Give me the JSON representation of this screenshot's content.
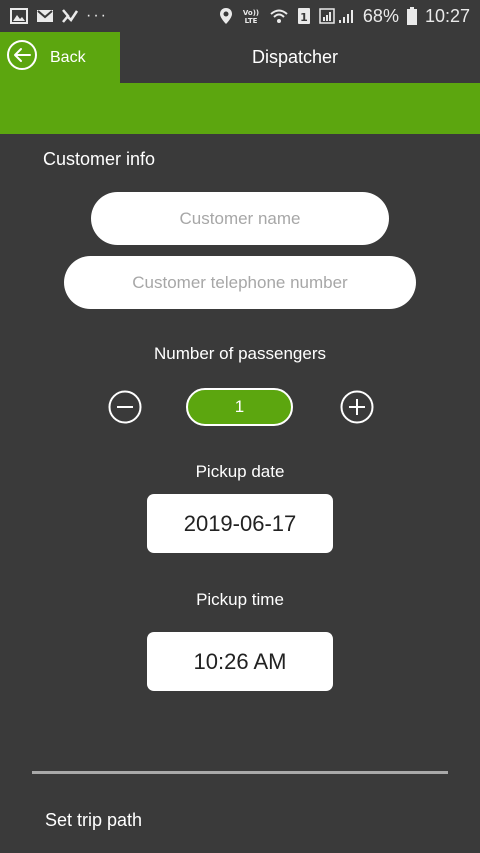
{
  "status_bar": {
    "dots": "···",
    "network_label": "VoLTE",
    "sim_badge": "1",
    "battery": "68%",
    "time": "10:27"
  },
  "header": {
    "back_label": "Back",
    "title": "Dispatcher"
  },
  "customer": {
    "section_label": "Customer info",
    "name_placeholder": "Customer name",
    "phone_placeholder": "Customer telephone number"
  },
  "passengers": {
    "label": "Number of passengers",
    "count": "1"
  },
  "pickup": {
    "date_label": "Pickup date",
    "date_value": "2019-06-17",
    "time_label": "Pickup time",
    "time_value": "10:26 AM"
  },
  "trip": {
    "label": "Set trip path"
  },
  "colors": {
    "accent": "#5ca60f",
    "background": "#3a3a3a"
  }
}
